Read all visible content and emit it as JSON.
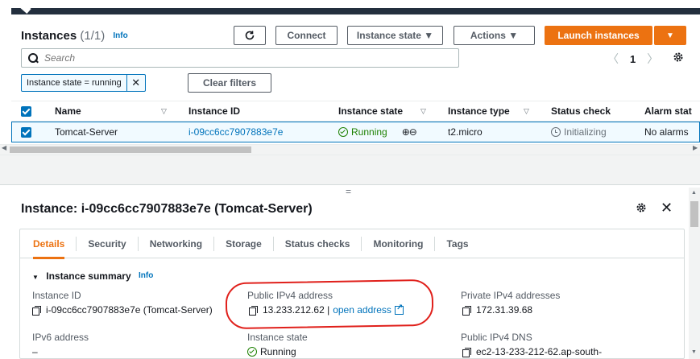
{
  "header": {
    "title": "Instances",
    "count": "(1/1)",
    "info": "Info",
    "refresh_icon": "refresh-icon",
    "connect": "Connect",
    "instance_state": "Instance state ▼",
    "actions": "Actions ▼",
    "launch": "Launch instances",
    "launch_dropdown": "▼"
  },
  "search": {
    "placeholder": "Search"
  },
  "pager": {
    "prev": "〈",
    "page": "1",
    "next": "〉"
  },
  "filter": {
    "token": "Instance state = running",
    "remove": "✕",
    "clear": "Clear filters"
  },
  "table": {
    "columns": {
      "name": "Name",
      "instance_id": "Instance ID",
      "instance_state": "Instance state",
      "instance_type": "Instance type",
      "status_check": "Status check",
      "alarm_status": "Alarm stat"
    },
    "sort_glyph": "▽",
    "rows": [
      {
        "name": "Tomcat-Server",
        "instance_id": "i-09cc6cc7907883e7e",
        "state": "Running",
        "zoom": "⊕⊖",
        "type": "t2.micro",
        "status": "Initializing",
        "alarm": "No alarms"
      }
    ]
  },
  "panel": {
    "drag": "=",
    "title": "Instance: i-09cc6cc7907883e7e (Tomcat-Server)",
    "close": "✕",
    "tabs": [
      "Details",
      "Security",
      "Networking",
      "Storage",
      "Status checks",
      "Monitoring",
      "Tags"
    ],
    "summary_title": "Instance summary",
    "summary_info": "Info",
    "fields": {
      "instance_id_label": "Instance ID",
      "instance_id_value": "i-09cc6cc7907883e7e (Tomcat-Server)",
      "public_ipv4_label": "Public IPv4 address",
      "public_ipv4_value": "13.233.212.62 |",
      "open_address": "open address",
      "private_ipv4_label": "Private IPv4 addresses",
      "private_ipv4_value": "172.31.39.68",
      "ipv6_label": "IPv6 address",
      "ipv6_value": "–",
      "state_label": "Instance state",
      "state_value": "Running",
      "public_dns_label": "Public IPv4 DNS",
      "public_dns_value": "ec2-13-233-212-62.ap-south-"
    }
  },
  "colors": {
    "accent": "#ec7211",
    "link": "#0073bb",
    "success": "#1d8102",
    "annotation": "#e0201b",
    "topbar": "#232f3e"
  }
}
